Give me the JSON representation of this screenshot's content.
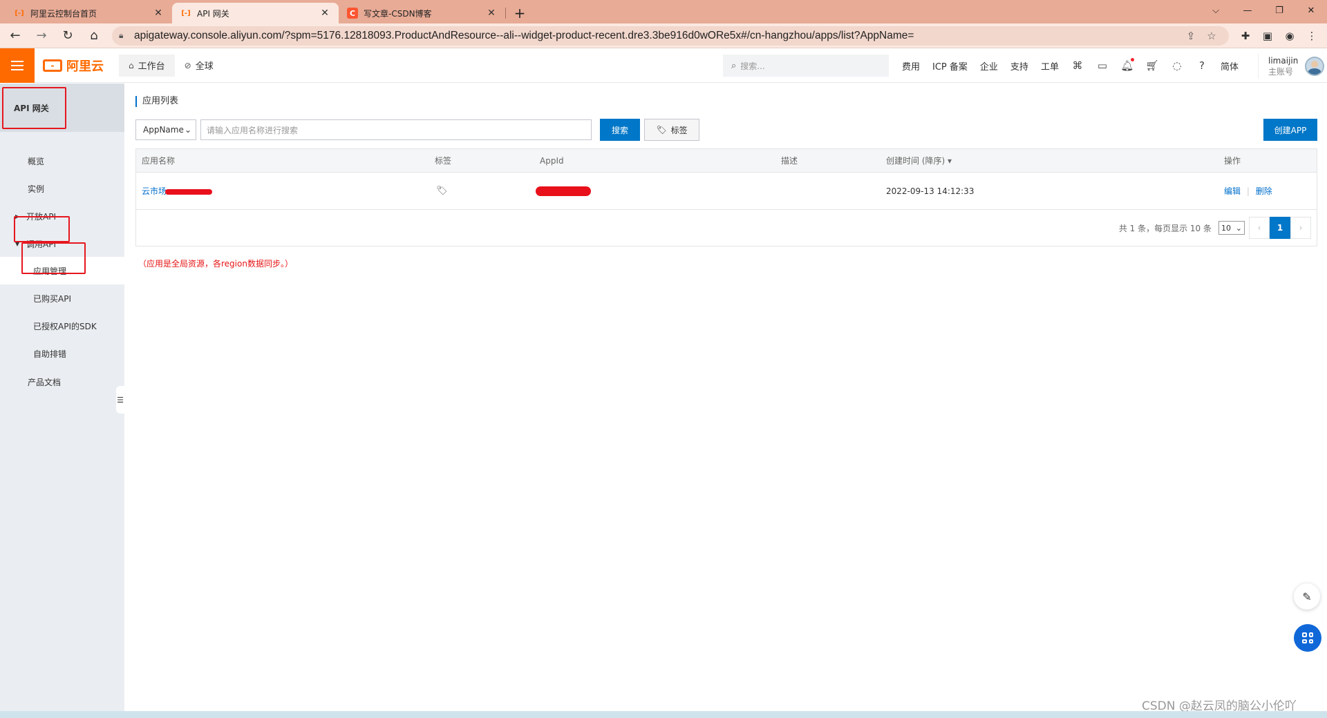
{
  "browser": {
    "tabs": [
      {
        "favicon": "aliyun-icon",
        "title": "阿里云控制台首页",
        "active": false
      },
      {
        "favicon": "aliyun-icon",
        "title": "API 网关",
        "active": true
      },
      {
        "favicon": "csdn-icon",
        "title": "写文章-CSDN博客",
        "active": false
      }
    ],
    "url": "apigateway.console.aliyun.com/?spm=5176.12818093.ProductAndResource--ali--widget-product-recent.dre3.3be916d0wORe5x#/cn-hangzhou/apps/list?AppName="
  },
  "topbar": {
    "logo_text": "阿里云",
    "nav": [
      {
        "icon": "home-icon",
        "label": "工作台"
      },
      {
        "icon": "globe-icon",
        "label": "全球"
      }
    ],
    "search_placeholder": "搜索...",
    "links": [
      "费用",
      "ICP 备案",
      "企业",
      "支持",
      "工单"
    ],
    "lang": "简体",
    "user": {
      "name": "limaijin",
      "role": "主账号"
    }
  },
  "sidebar": {
    "title": "API 网关",
    "items": [
      {
        "label": "概览"
      },
      {
        "label": "实例"
      },
      {
        "label": "开放API",
        "arrow": "right"
      },
      {
        "label": "调用API",
        "arrow": "down"
      },
      {
        "label": "应用管理",
        "active": true
      },
      {
        "label": "已购买API"
      },
      {
        "label": "已授权API的SDK"
      },
      {
        "label": "自助排错"
      },
      {
        "label": "产品文档"
      }
    ]
  },
  "main": {
    "title": "应用列表",
    "filter": {
      "select_value": "AppName",
      "input_placeholder": "请输入应用名称进行搜索",
      "search_button": "搜索",
      "tag_button": "标签",
      "create_button": "创建APP"
    },
    "table": {
      "columns": [
        "应用名称",
        "标签",
        "AppId",
        "描述",
        "创建时间 (降序)",
        "操作"
      ],
      "rows": [
        {
          "name": "云市场",
          "tag_icon": "tag-icon",
          "appid": "",
          "desc": "",
          "created": "2022-09-13 14:12:33",
          "actions": [
            "编辑",
            "删除"
          ]
        }
      ]
    },
    "pagination": {
      "info": "共 1 条，每页显示 10 条",
      "page_size": "10",
      "current_page": "1",
      "prev": "‹",
      "next": "›"
    },
    "note": "（应用是全局资源，各region数据同步。）"
  },
  "watermark": "CSDN @赵云凤的脑公小伦吖",
  "colors": {
    "accent": "#ff6a00",
    "primary": "#0077c8",
    "link": "#0070cc",
    "highlight": "#e6161e"
  }
}
